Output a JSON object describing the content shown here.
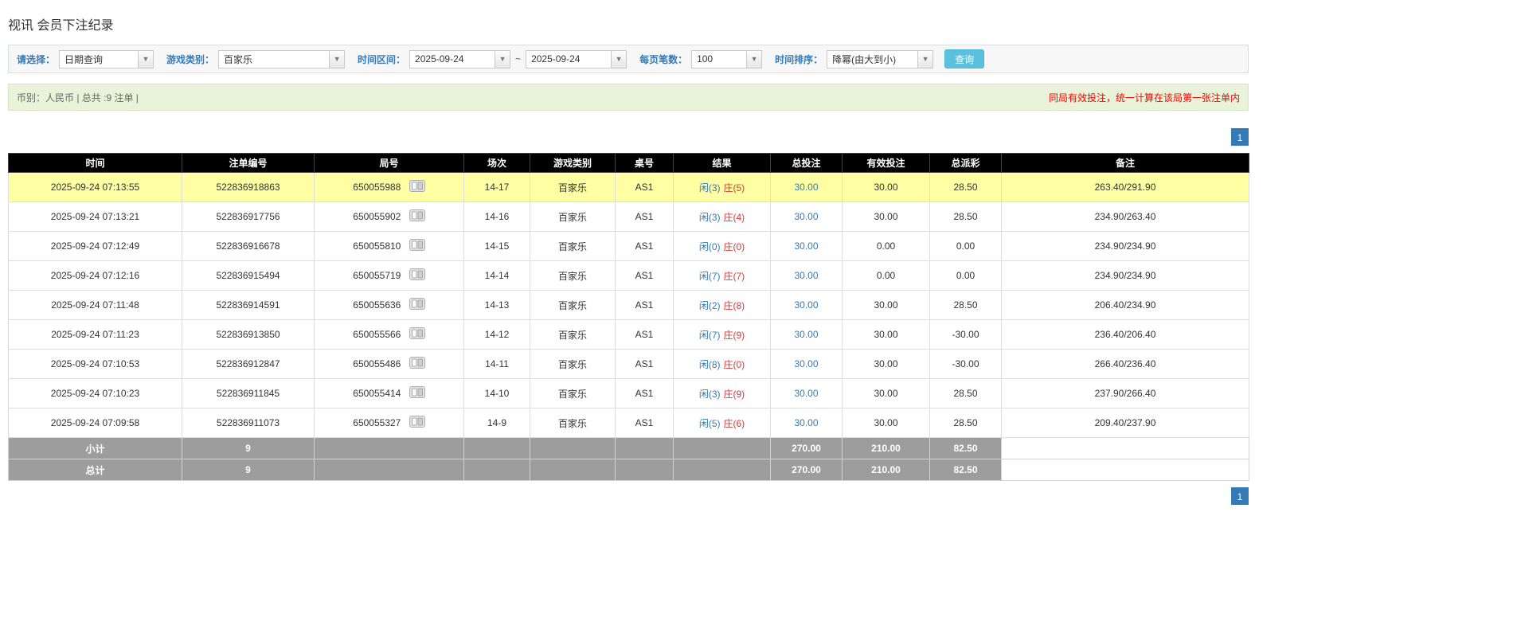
{
  "page": {
    "title": "视讯 会员下注纪录"
  },
  "filters": {
    "select_label": "请选择：",
    "select_value": "日期查询",
    "game_type_label": "游戏类别：",
    "game_type_value": "百家乐",
    "time_range_label": "时间区间：",
    "date_from": "2025-09-24",
    "date_to": "2025-09-24",
    "range_separator": "~",
    "page_size_label": "每页笔数：",
    "page_size_value": "100",
    "sort_label": "时间排序：",
    "sort_value": "降幂(由大到小)",
    "search_button": "查询",
    "caret": "▼"
  },
  "info_bar": {
    "left": "币别：人民币 | 总共 :9 注单 |",
    "right": "同局有效投注，统一计算在该局第一张注单内"
  },
  "pagination": {
    "page": "1"
  },
  "table": {
    "headers": [
      "时间",
      "注单编号",
      "局号",
      "场次",
      "游戏类别",
      "桌号",
      "结果",
      "总投注",
      "有效投注",
      "总派彩",
      "备注"
    ],
    "rows": [
      {
        "time": "2025-09-24 07:13:55",
        "bet_id": "522836918863",
        "round": "650055988",
        "session": "14-17",
        "game": "百家乐",
        "table": "AS1",
        "result_player": "闲(3)",
        "result_banker": "庄(5)",
        "total_bet": "30.00",
        "valid_bet": "30.00",
        "payout": "28.50",
        "note": "263.40/291.90",
        "highlight": true
      },
      {
        "time": "2025-09-24 07:13:21",
        "bet_id": "522836917756",
        "round": "650055902",
        "session": "14-16",
        "game": "百家乐",
        "table": "AS1",
        "result_player": "闲(3)",
        "result_banker": "庄(4)",
        "total_bet": "30.00",
        "valid_bet": "30.00",
        "payout": "28.50",
        "note": "234.90/263.40",
        "highlight": false
      },
      {
        "time": "2025-09-24 07:12:49",
        "bet_id": "522836916678",
        "round": "650055810",
        "session": "14-15",
        "game": "百家乐",
        "table": "AS1",
        "result_player": "闲(0)",
        "result_banker": "庄(0)",
        "total_bet": "30.00",
        "valid_bet": "0.00",
        "payout": "0.00",
        "note": "234.90/234.90",
        "highlight": false
      },
      {
        "time": "2025-09-24 07:12:16",
        "bet_id": "522836915494",
        "round": "650055719",
        "session": "14-14",
        "game": "百家乐",
        "table": "AS1",
        "result_player": "闲(7)",
        "result_banker": "庄(7)",
        "total_bet": "30.00",
        "valid_bet": "0.00",
        "payout": "0.00",
        "note": "234.90/234.90",
        "highlight": false
      },
      {
        "time": "2025-09-24 07:11:48",
        "bet_id": "522836914591",
        "round": "650055636",
        "session": "14-13",
        "game": "百家乐",
        "table": "AS1",
        "result_player": "闲(2)",
        "result_banker": "庄(8)",
        "total_bet": "30.00",
        "valid_bet": "30.00",
        "payout": "28.50",
        "note": "206.40/234.90",
        "highlight": false
      },
      {
        "time": "2025-09-24 07:11:23",
        "bet_id": "522836913850",
        "round": "650055566",
        "session": "14-12",
        "game": "百家乐",
        "table": "AS1",
        "result_player": "闲(7)",
        "result_banker": "庄(9)",
        "total_bet": "30.00",
        "valid_bet": "30.00",
        "payout": "-30.00",
        "note": "236.40/206.40",
        "highlight": false
      },
      {
        "time": "2025-09-24 07:10:53",
        "bet_id": "522836912847",
        "round": "650055486",
        "session": "14-11",
        "game": "百家乐",
        "table": "AS1",
        "result_player": "闲(8)",
        "result_banker": "庄(0)",
        "total_bet": "30.00",
        "valid_bet": "30.00",
        "payout": "-30.00",
        "note": "266.40/236.40",
        "highlight": false
      },
      {
        "time": "2025-09-24 07:10:23",
        "bet_id": "522836911845",
        "round": "650055414",
        "session": "14-10",
        "game": "百家乐",
        "table": "AS1",
        "result_player": "闲(3)",
        "result_banker": "庄(9)",
        "total_bet": "30.00",
        "valid_bet": "30.00",
        "payout": "28.50",
        "note": "237.90/266.40",
        "highlight": false
      },
      {
        "time": "2025-09-24 07:09:58",
        "bet_id": "522836911073",
        "round": "650055327",
        "session": "14-9",
        "game": "百家乐",
        "table": "AS1",
        "result_player": "闲(5)",
        "result_banker": "庄(6)",
        "total_bet": "30.00",
        "valid_bet": "30.00",
        "payout": "28.50",
        "note": "209.40/237.90",
        "highlight": false
      }
    ],
    "subtotal": {
      "label": "小计",
      "count": "9",
      "total_bet": "270.00",
      "valid_bet": "210.00",
      "payout": "82.50"
    },
    "total": {
      "label": "总计",
      "count": "9",
      "total_bet": "270.00",
      "valid_bet": "210.00",
      "payout": "82.50"
    }
  }
}
